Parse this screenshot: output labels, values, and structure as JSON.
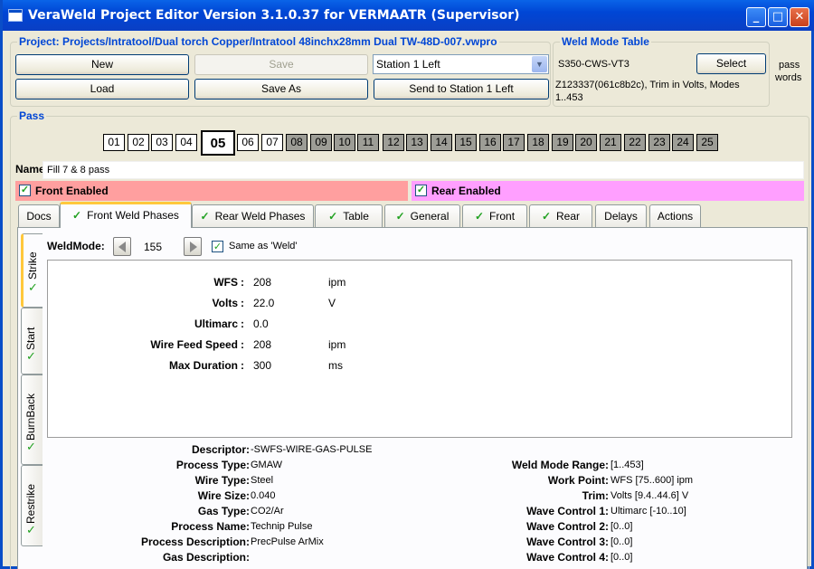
{
  "window": {
    "title": "VeraWeld Project Editor Version 3.1.0.37 for VERMAATR (Supervisor)",
    "minimize_glyph": "_",
    "maximize_glyph": "□",
    "close_glyph": "✕"
  },
  "project": {
    "group_title": "Project: Projects/Intratool/Dual torch Copper/Intratool 48inchx28mm Dual  TW-48D-007.vwpro",
    "new_label": "New",
    "save_label": "Save",
    "load_label": "Load",
    "save_as_label": "Save As",
    "station_value": "Station 1 Left",
    "send_label": "Send to Station 1 Left"
  },
  "weld_mode_table": {
    "group_title": "Weld Mode Table",
    "table_name": "S350-CWS-VT3",
    "select_label": "Select",
    "info_line1": "Z123337(061c8b2c), Trim in Volts, Modes",
    "info_line2": "1..453"
  },
  "passwords_label_line1": "pass",
  "passwords_label_line2": "words",
  "pass": {
    "group_title": "Pass",
    "buttons": [
      "01",
      "02",
      "03",
      "04",
      "05",
      "06",
      "07",
      "08",
      "09",
      "10",
      "11",
      "12",
      "13",
      "14",
      "15",
      "16",
      "17",
      "18",
      "19",
      "20",
      "21",
      "22",
      "23",
      "24",
      "25"
    ],
    "selected": "05",
    "name_label": "Name:",
    "name_value": "Fill 7 & 8 pass",
    "front_enabled_label": "Front Enabled",
    "rear_enabled_label": "Rear Enabled"
  },
  "colors": {
    "front_bar": "#ff9f9f",
    "rear_bar": "#ff9fff",
    "title_accent": "#0046d5",
    "check": "#21a121",
    "tab_highlight": "#ffc83c"
  },
  "tabs": {
    "docs": "Docs",
    "front_weld_phases": "Front Weld Phases",
    "rear_weld_phases": "Rear Weld Phases",
    "table": "Table",
    "general": "General",
    "front": "Front",
    "rear": "Rear",
    "delays": "Delays",
    "actions": "Actions",
    "check_glyph": "✓"
  },
  "phase_tabs": {
    "strike": "Strike",
    "start": "Start",
    "burnback": "BurnBack",
    "restrike": "Restrike"
  },
  "weldmode": {
    "label": "WeldMode:",
    "value": "155",
    "same_as_label": "Same as 'Weld'"
  },
  "params": [
    {
      "label": "WFS",
      "value": "208",
      "unit": "ipm"
    },
    {
      "label": "Volts",
      "value": "22.0",
      "unit": "V"
    },
    {
      "label": "Ultimarc",
      "value": "0.0",
      "unit": ""
    },
    {
      "label": "Wire Feed Speed",
      "value": "208",
      "unit": "ipm"
    },
    {
      "label": "Max Duration",
      "value": "300",
      "unit": "ms"
    }
  ],
  "param_separator": ":",
  "details_left": [
    {
      "label": "Descriptor:",
      "value": "-SWFS-WIRE-GAS-PULSE"
    },
    {
      "label": "Process Type:",
      "value": "GMAW"
    },
    {
      "label": "Wire Type:",
      "value": "Steel"
    },
    {
      "label": "Wire Size:",
      "value": "0.040"
    },
    {
      "label": "Gas Type:",
      "value": "CO2/Ar"
    },
    {
      "label": "Process Name:",
      "value": "Technip Pulse"
    },
    {
      "label": "Process Description:",
      "value": "PrecPulse ArMix"
    },
    {
      "label": "Gas Description:",
      "value": ""
    }
  ],
  "details_right": [
    {
      "label": "Weld Mode Range:",
      "value": "[1..453]"
    },
    {
      "label": "Work Point:",
      "value": "WFS [75..600] ipm"
    },
    {
      "label": "Trim:",
      "value": "Volts [9.4..44.6] V"
    },
    {
      "label": "Wave Control 1:",
      "value": "Ultimarc [-10..10]"
    },
    {
      "label": "Wave Control 2:",
      "value": "[0..0]"
    },
    {
      "label": "Wave Control 3:",
      "value": "[0..0]"
    },
    {
      "label": "Wave Control 4:",
      "value": "[0..0]"
    }
  ]
}
